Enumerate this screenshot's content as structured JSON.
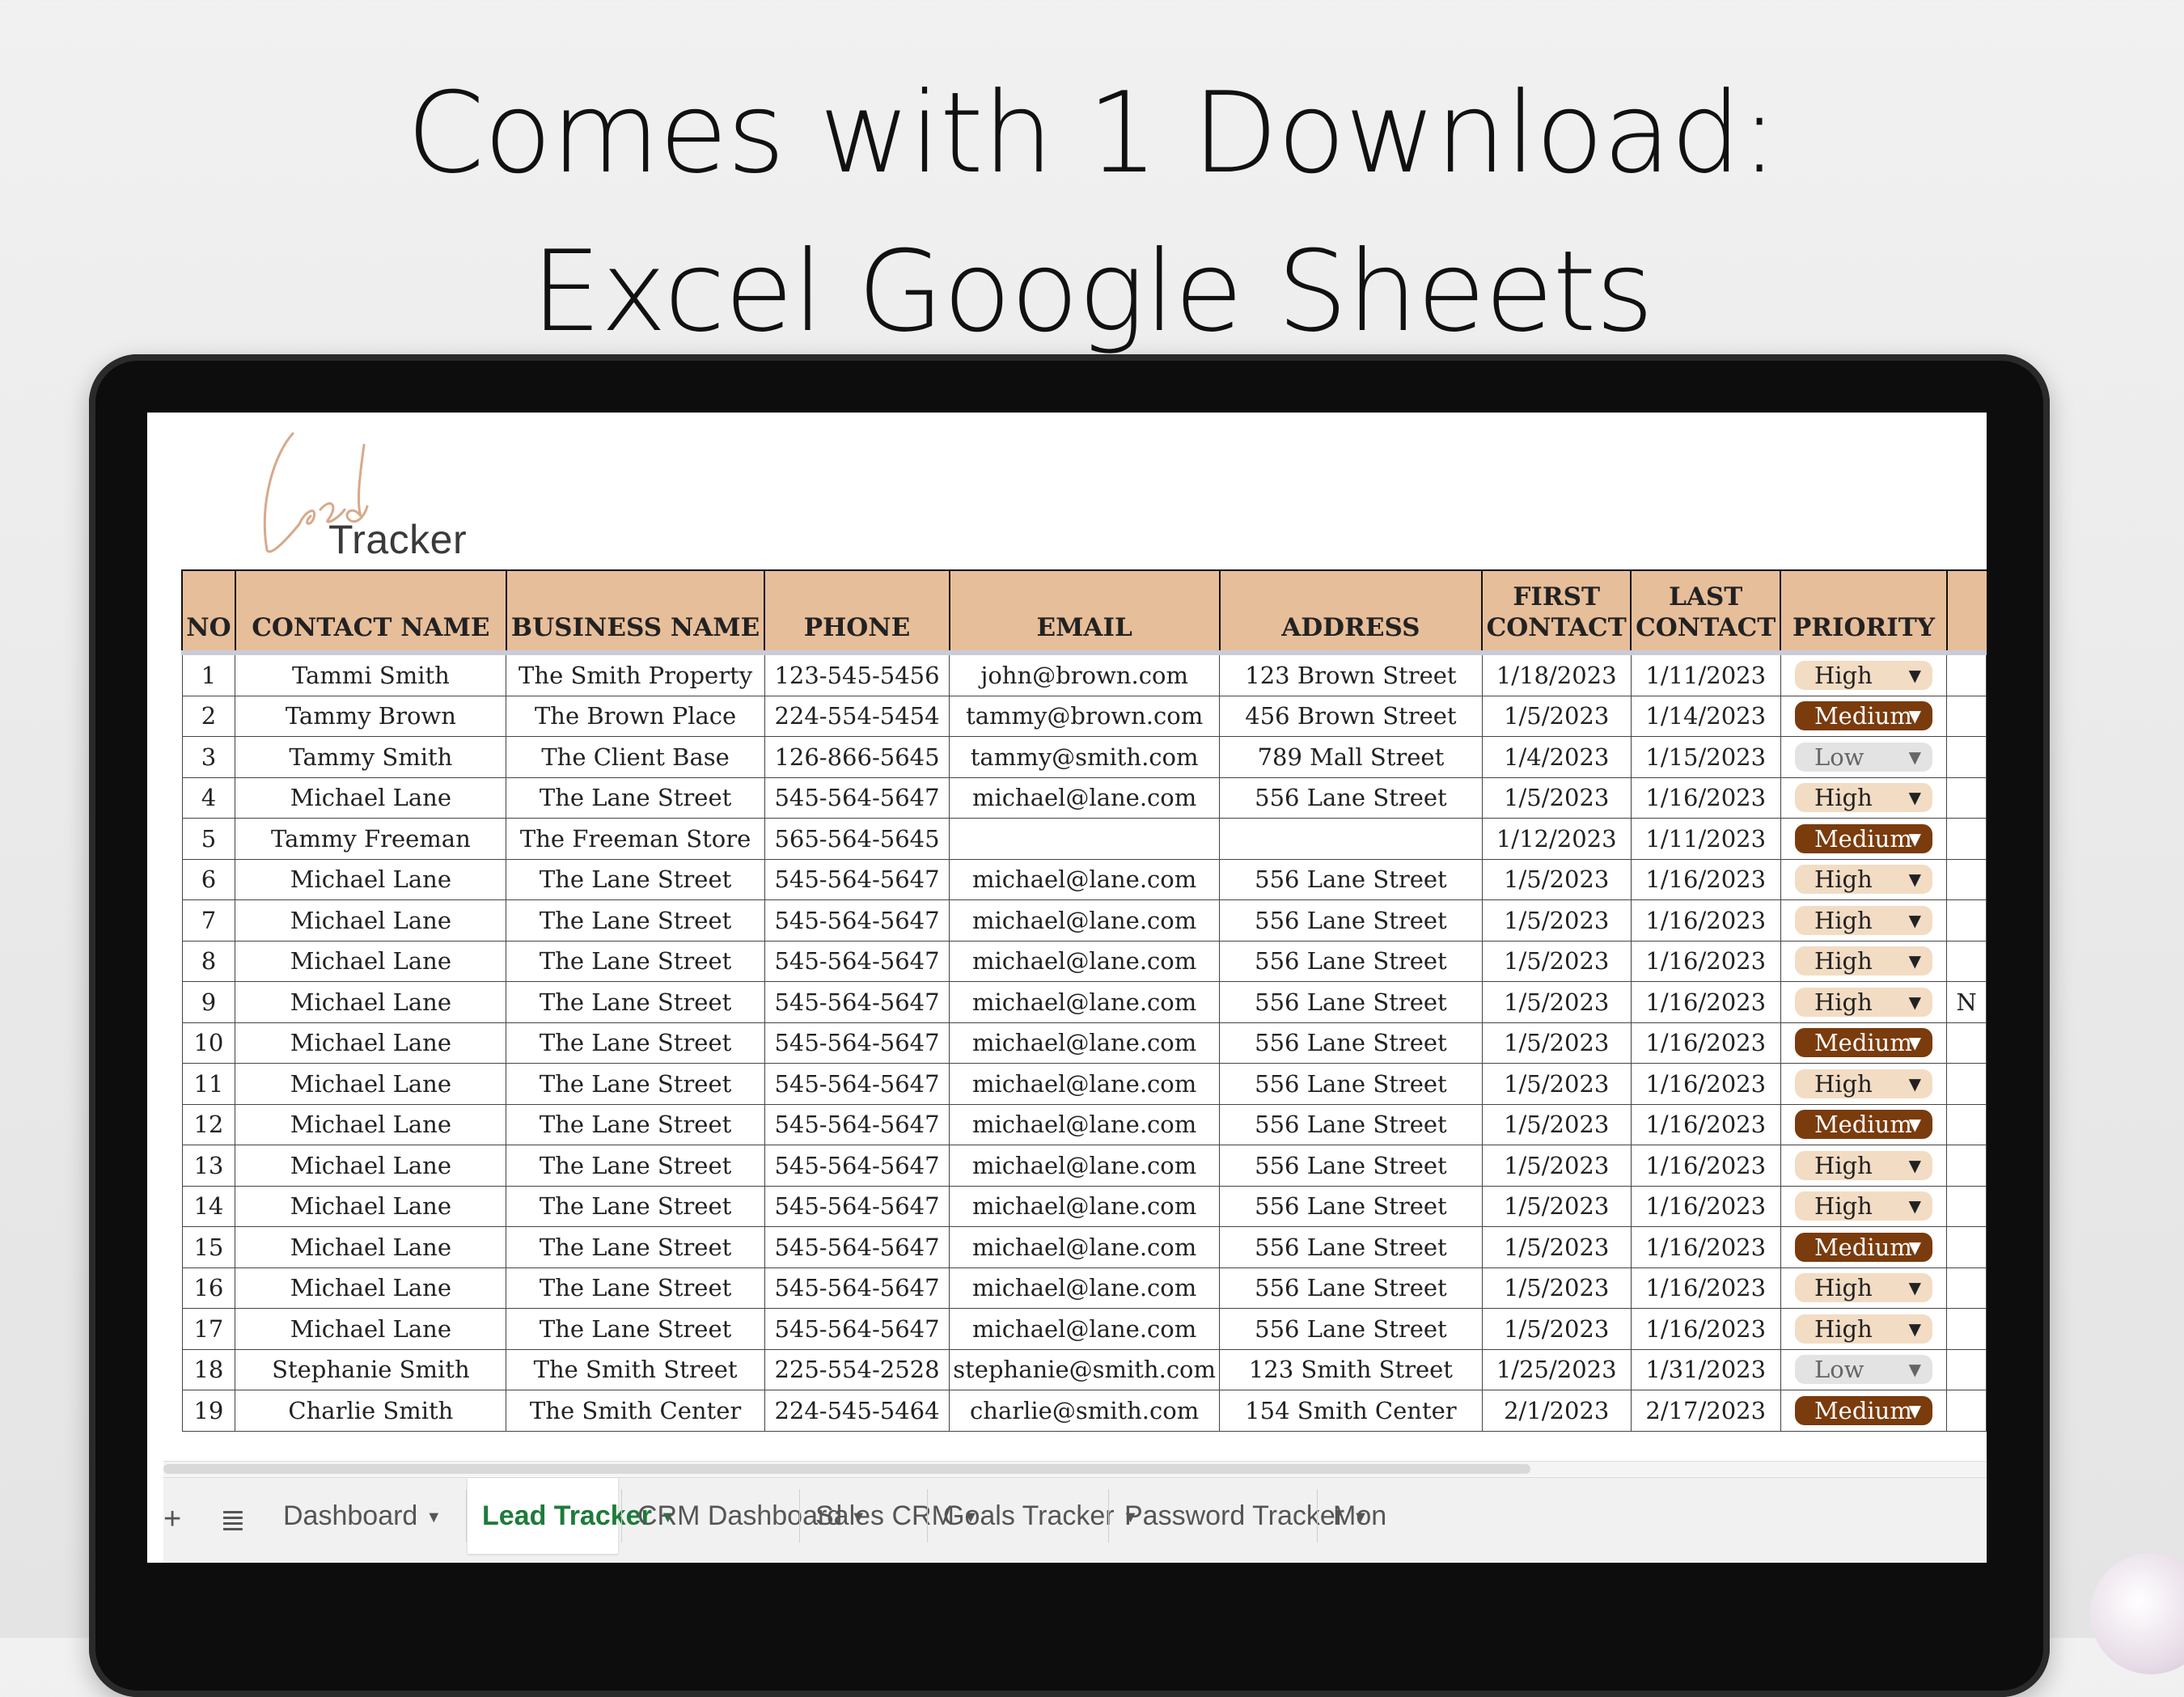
{
  "headline": {
    "line1": "Comes with 1 Download:",
    "line2": "Excel Google Sheets"
  },
  "logo": {
    "script": "Lead",
    "text": "Tracker"
  },
  "table": {
    "headers": [
      {
        "l1": "",
        "l2": "NO"
      },
      {
        "l1": "",
        "l2": "CONTACT NAME"
      },
      {
        "l1": "",
        "l2": "BUSINESS NAME"
      },
      {
        "l1": "",
        "l2": "PHONE"
      },
      {
        "l1": "",
        "l2": "EMAIL"
      },
      {
        "l1": "",
        "l2": "ADDRESS"
      },
      {
        "l1": "FIRST",
        "l2": "CONTACT"
      },
      {
        "l1": "LAST",
        "l2": "CONTACT"
      },
      {
        "l1": "",
        "l2": "PRIORITY"
      }
    ],
    "rows": [
      {
        "no": "1",
        "name": "Tammi Smith",
        "business": "The Smith Property",
        "phone": "123-545-5456",
        "email": "john@brown.com",
        "address": "123 Brown Street",
        "first": "1/18/2023",
        "last": "1/11/2023",
        "priority": "High",
        "extra": ""
      },
      {
        "no": "2",
        "name": "Tammy Brown",
        "business": "The Brown Place",
        "phone": "224-554-5454",
        "email": "tammy@brown.com",
        "address": "456 Brown Street",
        "first": "1/5/2023",
        "last": "1/14/2023",
        "priority": "Medium",
        "extra": ""
      },
      {
        "no": "3",
        "name": "Tammy Smith",
        "business": "The Client Base",
        "phone": "126-866-5645",
        "email": "tammy@smith.com",
        "address": "789 Mall Street",
        "first": "1/4/2023",
        "last": "1/15/2023",
        "priority": "Low",
        "extra": ""
      },
      {
        "no": "4",
        "name": "Michael Lane",
        "business": "The Lane Street",
        "phone": "545-564-5647",
        "email": "michael@lane.com",
        "address": "556 Lane Street",
        "first": "1/5/2023",
        "last": "1/16/2023",
        "priority": "High",
        "extra": ""
      },
      {
        "no": "5",
        "name": "Tammy Freeman",
        "business": "The Freeman Store",
        "phone": "565-564-5645",
        "email": "",
        "address": "",
        "first": "1/12/2023",
        "last": "1/11/2023",
        "priority": "Medium",
        "extra": ""
      },
      {
        "no": "6",
        "name": "Michael Lane",
        "business": "The Lane Street",
        "phone": "545-564-5647",
        "email": "michael@lane.com",
        "address": "556 Lane Street",
        "first": "1/5/2023",
        "last": "1/16/2023",
        "priority": "High",
        "extra": ""
      },
      {
        "no": "7",
        "name": "Michael Lane",
        "business": "The Lane Street",
        "phone": "545-564-5647",
        "email": "michael@lane.com",
        "address": "556 Lane Street",
        "first": "1/5/2023",
        "last": "1/16/2023",
        "priority": "High",
        "extra": ""
      },
      {
        "no": "8",
        "name": "Michael Lane",
        "business": "The Lane Street",
        "phone": "545-564-5647",
        "email": "michael@lane.com",
        "address": "556 Lane Street",
        "first": "1/5/2023",
        "last": "1/16/2023",
        "priority": "High",
        "extra": ""
      },
      {
        "no": "9",
        "name": "Michael Lane",
        "business": "The Lane Street",
        "phone": "545-564-5647",
        "email": "michael@lane.com",
        "address": "556 Lane Street",
        "first": "1/5/2023",
        "last": "1/16/2023",
        "priority": "High",
        "extra": "N"
      },
      {
        "no": "10",
        "name": "Michael Lane",
        "business": "The Lane Street",
        "phone": "545-564-5647",
        "email": "michael@lane.com",
        "address": "556 Lane Street",
        "first": "1/5/2023",
        "last": "1/16/2023",
        "priority": "Medium",
        "extra": ""
      },
      {
        "no": "11",
        "name": "Michael Lane",
        "business": "The Lane Street",
        "phone": "545-564-5647",
        "email": "michael@lane.com",
        "address": "556 Lane Street",
        "first": "1/5/2023",
        "last": "1/16/2023",
        "priority": "High",
        "extra": ""
      },
      {
        "no": "12",
        "name": "Michael Lane",
        "business": "The Lane Street",
        "phone": "545-564-5647",
        "email": "michael@lane.com",
        "address": "556 Lane Street",
        "first": "1/5/2023",
        "last": "1/16/2023",
        "priority": "Medium",
        "extra": ""
      },
      {
        "no": "13",
        "name": "Michael Lane",
        "business": "The Lane Street",
        "phone": "545-564-5647",
        "email": "michael@lane.com",
        "address": "556 Lane Street",
        "first": "1/5/2023",
        "last": "1/16/2023",
        "priority": "High",
        "extra": ""
      },
      {
        "no": "14",
        "name": "Michael Lane",
        "business": "The Lane Street",
        "phone": "545-564-5647",
        "email": "michael@lane.com",
        "address": "556 Lane Street",
        "first": "1/5/2023",
        "last": "1/16/2023",
        "priority": "High",
        "extra": ""
      },
      {
        "no": "15",
        "name": "Michael Lane",
        "business": "The Lane Street",
        "phone": "545-564-5647",
        "email": "michael@lane.com",
        "address": "556 Lane Street",
        "first": "1/5/2023",
        "last": "1/16/2023",
        "priority": "Medium",
        "extra": ""
      },
      {
        "no": "16",
        "name": "Michael Lane",
        "business": "The Lane Street",
        "phone": "545-564-5647",
        "email": "michael@lane.com",
        "address": "556 Lane Street",
        "first": "1/5/2023",
        "last": "1/16/2023",
        "priority": "High",
        "extra": ""
      },
      {
        "no": "17",
        "name": "Michael Lane",
        "business": "The Lane Street",
        "phone": "545-564-5647",
        "email": "michael@lane.com",
        "address": "556 Lane Street",
        "first": "1/5/2023",
        "last": "1/16/2023",
        "priority": "High",
        "extra": ""
      },
      {
        "no": "18",
        "name": "Stephanie Smith",
        "business": "The Smith Street",
        "phone": "225-554-2528",
        "email": "stephanie@smith.com",
        "address": "123 Smith Street",
        "first": "1/25/2023",
        "last": "1/31/2023",
        "priority": "Low",
        "extra": ""
      },
      {
        "no": "19",
        "name": "Charlie Smith",
        "business": "The Smith Center",
        "phone": "224-545-5464",
        "email": "charlie@smith.com",
        "address": "154 Smith Center",
        "first": "2/1/2023",
        "last": "2/17/2023",
        "priority": "Medium",
        "extra": ""
      }
    ]
  },
  "tabs": [
    {
      "label": "Dashboard",
      "active": false
    },
    {
      "label": "Lead Tracker",
      "active": true
    },
    {
      "label": "CRM Dashboard",
      "active": false
    },
    {
      "label": "Sales CRM",
      "active": false
    },
    {
      "label": "Goals Tracker",
      "active": false
    },
    {
      "label": "Password Tracker",
      "active": false
    },
    {
      "label": "Mon",
      "active": false
    }
  ],
  "icons": {
    "add_sheet": "plus-icon",
    "all_sheets": "list-icon",
    "dropdown": "caret-down-icon"
  },
  "colors": {
    "header_bg": "#e7be9a",
    "high": "#f3dcc4",
    "medium": "#7a3b0d",
    "low": "#e3e3e3",
    "active_tab": "#1e7b3a"
  }
}
